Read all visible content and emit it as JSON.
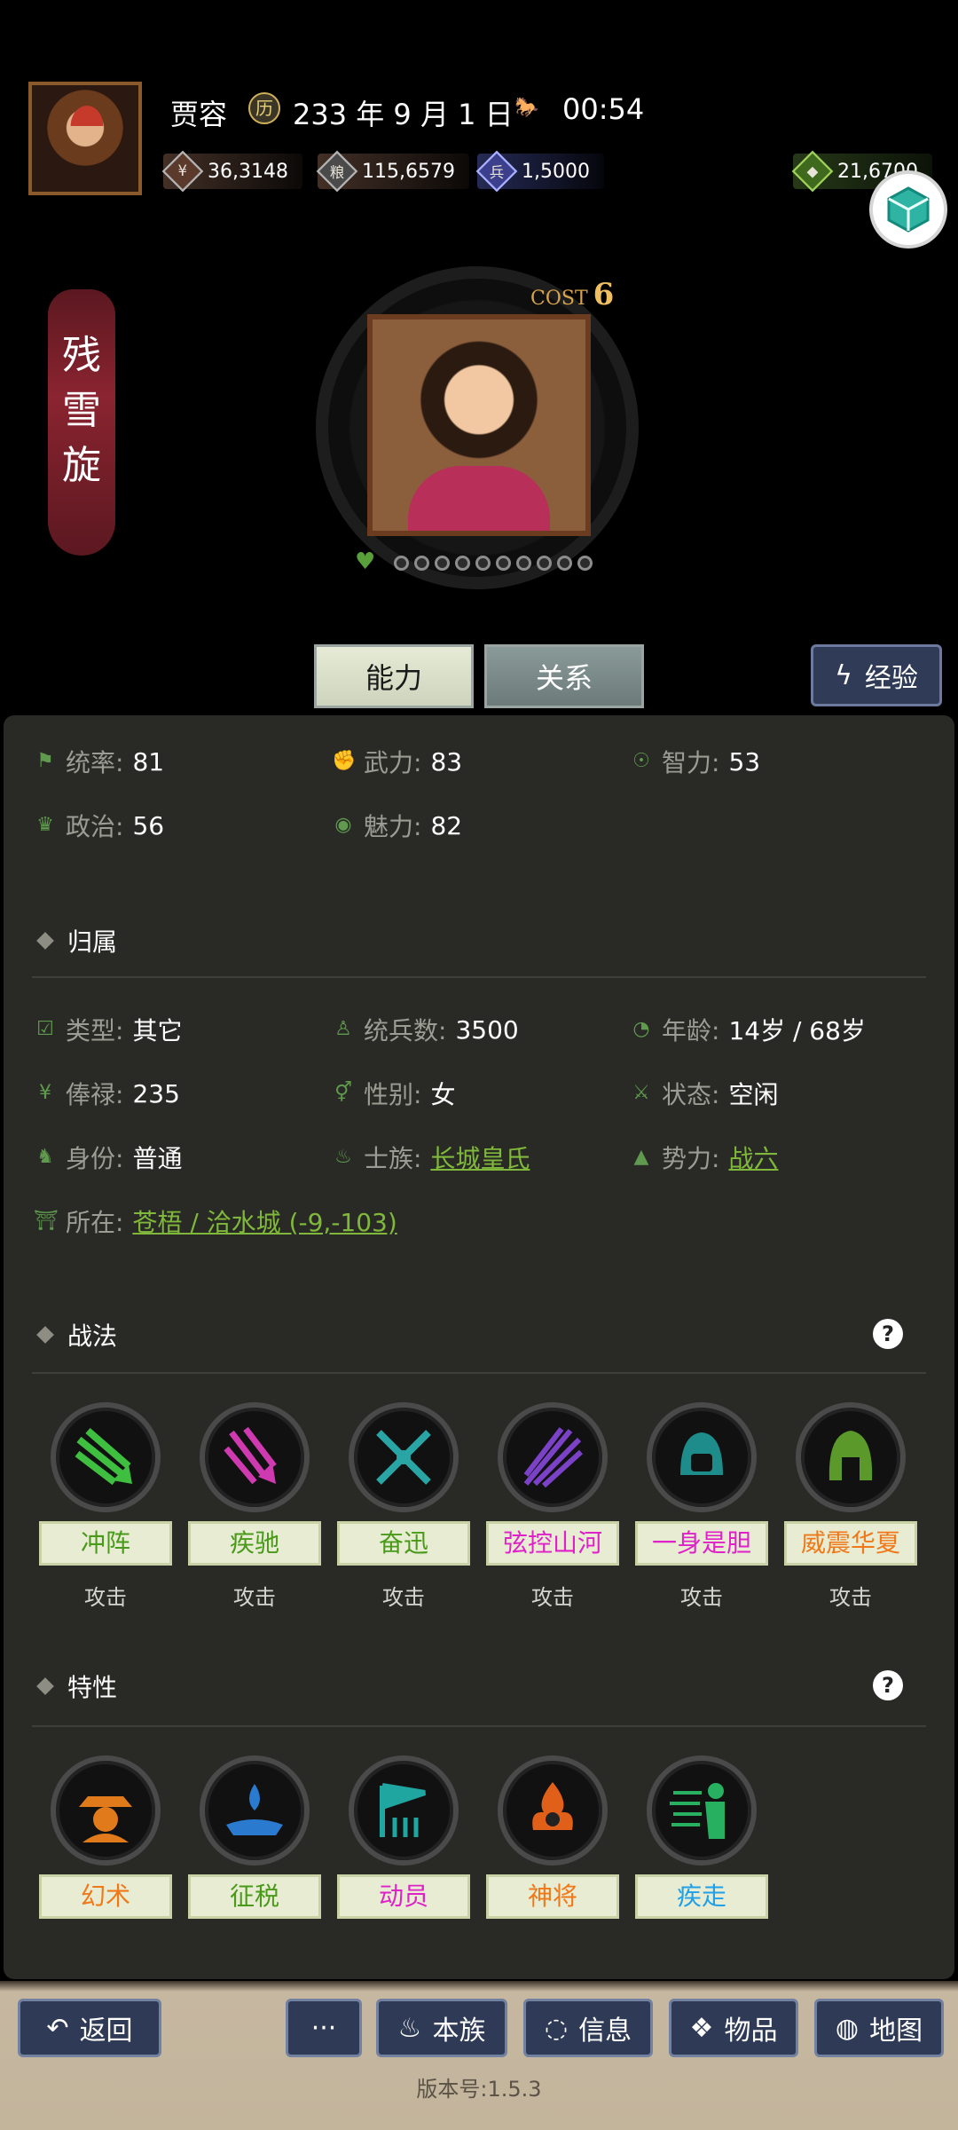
{
  "header": {
    "name": "贾容",
    "date": "233 年 9 月 1 日",
    "time": "00:54",
    "resources": [
      {
        "icon": "coin-icon",
        "value": "36,3148"
      },
      {
        "icon": "grain-icon",
        "value": "115,6579"
      },
      {
        "icon": "soldier-icon",
        "value": "1,5000"
      },
      {
        "icon": "money-bag-icon",
        "value": "21,6700"
      }
    ]
  },
  "character": {
    "title_banner": "残雪旋",
    "cost_label": "COST",
    "cost_value": "6",
    "favor_dots": 10
  },
  "tabs": {
    "ability": "能力",
    "relation": "关系",
    "experience": "经验"
  },
  "stats": {
    "command": {
      "label": "统率:",
      "value": "81"
    },
    "force": {
      "label": "武力:",
      "value": "83"
    },
    "intelligence": {
      "label": "智力:",
      "value": "53"
    },
    "politics": {
      "label": "政治:",
      "value": "56"
    },
    "charm": {
      "label": "魅力:",
      "value": "82"
    }
  },
  "affiliation": {
    "title": "归属",
    "type": {
      "label": "类型:",
      "value": "其它"
    },
    "troops": {
      "label": "统兵数:",
      "value": "3500"
    },
    "age": {
      "label": "年龄:",
      "value": "14岁 / 68岁"
    },
    "salary": {
      "label": "俸禄:",
      "value": "235"
    },
    "gender": {
      "label": "性别:",
      "value": "女"
    },
    "status": {
      "label": "状态:",
      "value": "空闲"
    },
    "identity": {
      "label": "身份:",
      "value": "普通"
    },
    "clan": {
      "label": "士族:",
      "value": "长城皇氏"
    },
    "faction": {
      "label": "势力:",
      "value": "战六"
    },
    "location": {
      "label": "所在:",
      "value": "苍梧 / 洽水城 (-9,-103)"
    }
  },
  "tactics": {
    "title": "战法",
    "items": [
      {
        "name": "冲阵",
        "type": "攻击",
        "color": "#4a9a1a"
      },
      {
        "name": "疾驰",
        "type": "攻击",
        "color": "#4a9a1a"
      },
      {
        "name": "奋迅",
        "type": "攻击",
        "color": "#4a9a1a"
      },
      {
        "name": "弦控山河",
        "type": "攻击",
        "color": "#e020c8"
      },
      {
        "name": "一身是胆",
        "type": "攻击",
        "color": "#e020c8"
      },
      {
        "name": "威震华夏",
        "type": "攻击",
        "color": "#f07818"
      }
    ]
  },
  "traits": {
    "title": "特性",
    "items": [
      {
        "name": "幻术",
        "color": "#f07818"
      },
      {
        "name": "征税",
        "color": "#4a9a1a"
      },
      {
        "name": "动员",
        "color": "#e020c8"
      },
      {
        "name": "神将",
        "color": "#f07818"
      },
      {
        "name": "疾走",
        "color": "#20a0e8"
      }
    ]
  },
  "bottom": {
    "back": "返回",
    "more": "···",
    "clan": "本族",
    "info": "信息",
    "items": "物品",
    "map": "地图",
    "version": "版本号:1.5.3"
  }
}
